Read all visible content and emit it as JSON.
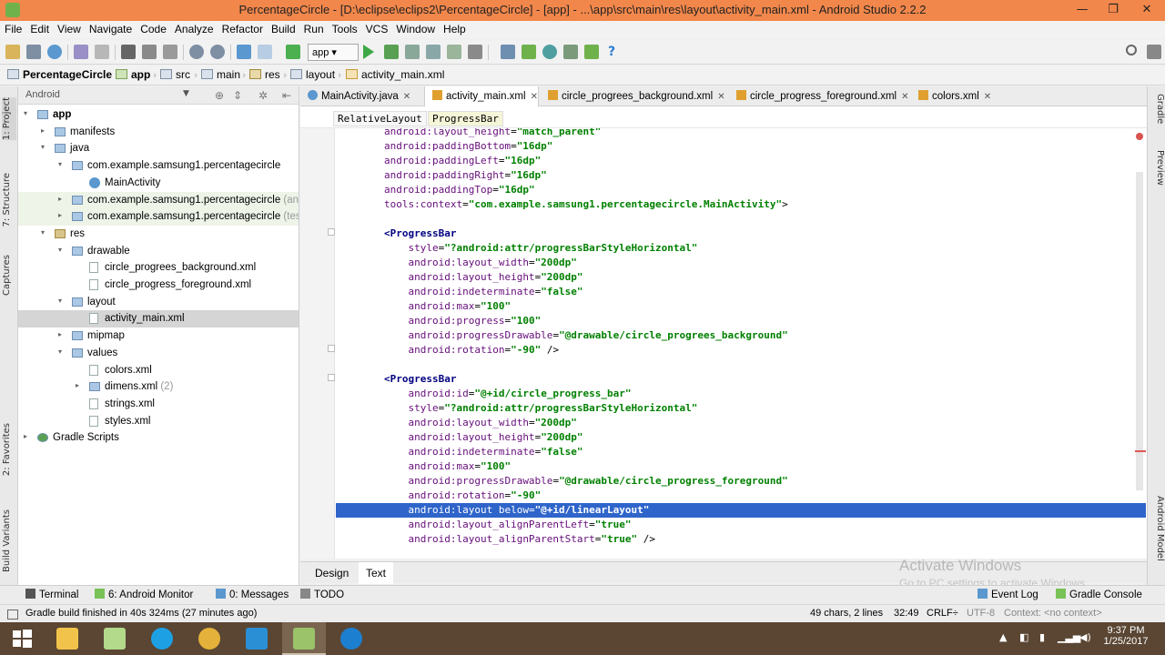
{
  "window": {
    "title": "PercentageCircle - [D:\\eclipse\\eclips2\\PercentageCircle] - [app] - ...\\app\\src\\main\\res\\layout\\activity_main.xml - Android Studio 2.2.2",
    "minimize": "—",
    "maximize": "❐",
    "close": "✕"
  },
  "menu": [
    "File",
    "Edit",
    "View",
    "Navigate",
    "Code",
    "Analyze",
    "Refactor",
    "Build",
    "Run",
    "Tools",
    "VCS",
    "Window",
    "Help"
  ],
  "toolbar": {
    "run_config": "app ▾",
    "icons": [
      "open-icon",
      "save-icon",
      "sync-icon",
      "undo-icon",
      "redo-icon",
      "cut-icon",
      "copy-icon",
      "paste-icon",
      "find-icon",
      "replace-icon",
      "back-icon",
      "forward-icon",
      "build-icon",
      "run-icon",
      "debug-icon",
      "profile-icon",
      "attach-icon",
      "stop-icon",
      "avd-manager-icon",
      "sdk-manager-icon",
      "gradle-sync-icon",
      "device-monitor-icon",
      "help-icon",
      "search-icon"
    ]
  },
  "breadcrumb": [
    "PercentageCircle",
    "app",
    "src",
    "main",
    "res",
    "layout",
    "activity_main.xml"
  ],
  "left_strip": [
    "1: Project",
    "7: Structure",
    "Captures",
    "2: Favorites",
    "Build Variants"
  ],
  "project_panel": {
    "view_selector": "Android",
    "tree": [
      {
        "label": "app",
        "depth": 0,
        "arrow": "▾",
        "icon": "folder",
        "bold": true
      },
      {
        "label": "manifests",
        "depth": 1,
        "arrow": "▸",
        "icon": "folder"
      },
      {
        "label": "java",
        "depth": 1,
        "arrow": "▾",
        "icon": "folder"
      },
      {
        "label": "com.example.samsung1.percentagecircle",
        "depth": 2,
        "arrow": "▾",
        "icon": "folder"
      },
      {
        "label": "MainActivity",
        "depth": 3,
        "arrow": "",
        "icon": "class"
      },
      {
        "label": "com.example.samsung1.percentagecircle",
        "suffix": " (andr",
        "depth": 2,
        "arrow": "▸",
        "icon": "folder",
        "tinted": true
      },
      {
        "label": "com.example.samsung1.percentagecircle",
        "suffix": " (test)",
        "depth": 2,
        "arrow": "▸",
        "icon": "folder",
        "tinted": true
      },
      {
        "label": "res",
        "depth": 1,
        "arrow": "▾",
        "icon": "res"
      },
      {
        "label": "drawable",
        "depth": 2,
        "arrow": "▾",
        "icon": "folder"
      },
      {
        "label": "circle_progrees_background.xml",
        "depth": 3,
        "arrow": "",
        "icon": "xml"
      },
      {
        "label": "circle_progress_foreground.xml",
        "depth": 3,
        "arrow": "",
        "icon": "xml"
      },
      {
        "label": "layout",
        "depth": 2,
        "arrow": "▾",
        "icon": "folder"
      },
      {
        "label": "activity_main.xml",
        "depth": 3,
        "arrow": "",
        "icon": "xml",
        "selected": true
      },
      {
        "label": "mipmap",
        "depth": 2,
        "arrow": "▸",
        "icon": "folder"
      },
      {
        "label": "values",
        "depth": 2,
        "arrow": "▾",
        "icon": "folder"
      },
      {
        "label": "colors.xml",
        "depth": 3,
        "arrow": "",
        "icon": "xml"
      },
      {
        "label": "dimens.xml",
        "suffix": " (2)",
        "depth": 3,
        "arrow": "▸",
        "icon": "folder"
      },
      {
        "label": "strings.xml",
        "depth": 3,
        "arrow": "",
        "icon": "xml"
      },
      {
        "label": "styles.xml",
        "depth": 3,
        "arrow": "",
        "icon": "xml"
      },
      {
        "label": "Gradle Scripts",
        "depth": 0,
        "arrow": "▸",
        "icon": "gradle"
      }
    ]
  },
  "editor_tabs": [
    {
      "label": "MainActivity.java",
      "active": false,
      "color": "#5a98cf"
    },
    {
      "label": "activity_main.xml",
      "active": true,
      "color": "#e0a030"
    },
    {
      "label": "circle_progrees_background.xml",
      "active": false,
      "color": "#e0a030"
    },
    {
      "label": "circle_progress_foreground.xml",
      "active": false,
      "color": "#e0a030"
    },
    {
      "label": "colors.xml",
      "active": false,
      "color": "#e0a030"
    }
  ],
  "xml_crumbs": [
    "RelativeLayout",
    "ProgressBar"
  ],
  "code_lines": [
    {
      "indent": "    ",
      "ns": "android:",
      "attr": "layout_height",
      "val": "\"match_parent\""
    },
    {
      "indent": "    ",
      "ns": "android:",
      "attr": "paddingBottom",
      "val": "\"16dp\""
    },
    {
      "indent": "    ",
      "ns": "android:",
      "attr": "paddingLeft",
      "val": "\"16dp\""
    },
    {
      "indent": "    ",
      "ns": "android:",
      "attr": "paddingRight",
      "val": "\"16dp\""
    },
    {
      "indent": "    ",
      "ns": "android:",
      "attr": "paddingTop",
      "val": "\"16dp\""
    },
    {
      "indent": "    ",
      "ns": "tools:",
      "attr": "context",
      "val": "\"com.example.samsung1.percentagecircle.MainActivity\"",
      "tail": ">"
    },
    {
      "indent": "",
      "raw": ""
    },
    {
      "indent": "    ",
      "tag": "<ProgressBar"
    },
    {
      "indent": "        ",
      "ns": "",
      "attr": "style",
      "val": "\"?android:attr/progressBarStyleHorizontal\""
    },
    {
      "indent": "        ",
      "ns": "android:",
      "attr": "layout_width",
      "val": "\"200dp\""
    },
    {
      "indent": "        ",
      "ns": "android:",
      "attr": "layout_height",
      "val": "\"200dp\""
    },
    {
      "indent": "        ",
      "ns": "android:",
      "attr": "indeterminate",
      "val": "\"false\""
    },
    {
      "indent": "        ",
      "ns": "android:",
      "attr": "max",
      "val": "\"100\""
    },
    {
      "indent": "        ",
      "ns": "android:",
      "attr": "progress",
      "val": "\"100\""
    },
    {
      "indent": "        ",
      "ns": "android:",
      "attr": "progressDrawable",
      "val": "\"@drawable/circle_progrees_background\""
    },
    {
      "indent": "        ",
      "ns": "android:",
      "attr": "rotation",
      "val": "\"-90\"",
      "tail": " />"
    },
    {
      "indent": "",
      "raw": ""
    },
    {
      "indent": "    ",
      "tag": "<ProgressBar"
    },
    {
      "indent": "        ",
      "ns": "android:",
      "attr": "id",
      "val": "\"@+id/circle_progress_bar\""
    },
    {
      "indent": "        ",
      "ns": "",
      "attr": "style",
      "val": "\"?android:attr/progressBarStyleHorizontal\""
    },
    {
      "indent": "        ",
      "ns": "android:",
      "attr": "layout_width",
      "val": "\"200dp\""
    },
    {
      "indent": "        ",
      "ns": "android:",
      "attr": "layout_height",
      "val": "\"200dp\""
    },
    {
      "indent": "        ",
      "ns": "android:",
      "attr": "indeterminate",
      "val": "\"false\""
    },
    {
      "indent": "        ",
      "ns": "android:",
      "attr": "max",
      "val": "\"100\""
    },
    {
      "indent": "        ",
      "ns": "android:",
      "attr": "progressDrawable",
      "val": "\"@drawable/circle_progress_foreground\""
    },
    {
      "indent": "        ",
      "ns": "android:",
      "attr": "rotation",
      "val": "\"-90\""
    },
    {
      "indent": "        ",
      "ns": "android:",
      "attr": "layout below",
      "val": "\"@+id/linearLayout\"",
      "highlight": true
    },
    {
      "indent": "        ",
      "ns": "android:",
      "attr": "layout_alignParentLeft",
      "val": "\"true\""
    },
    {
      "indent": "        ",
      "ns": "android:",
      "attr": "layout_alignParentStart",
      "val": "\"true\"",
      "tail": " />"
    }
  ],
  "design_tabs": [
    {
      "label": "Design",
      "active": false
    },
    {
      "label": "Text",
      "active": true
    }
  ],
  "watermark": {
    "line1": "Activate Windows",
    "line2": "Go to PC settings to activate Windows."
  },
  "right_strip": [
    "Gradle",
    "Preview",
    "Android Model"
  ],
  "bottom_tools": [
    {
      "label": "Terminal",
      "color": "#555"
    },
    {
      "label": "6: Android Monitor",
      "color": "#78c257"
    },
    {
      "label": "0: Messages",
      "color": "#5a98cf"
    },
    {
      "label": "TODO",
      "color": "#888"
    },
    {
      "label": "Event Log",
      "color": "#5a98cf"
    },
    {
      "label": "Gradle Console",
      "color": "#78c257"
    }
  ],
  "status": {
    "message": "Gradle build finished in 40s 324ms (27 minutes ago)",
    "selection": "49 chars, 2 lines",
    "position": "32:49",
    "line_sep": "CRLF÷",
    "encoding": "UTF-8",
    "context": "Context: <no context>"
  },
  "taskbar": {
    "apps": [
      {
        "name": "file-explorer",
        "color": "#f1c34b"
      },
      {
        "name": "notepad",
        "color": "#b3d98a"
      },
      {
        "name": "skype",
        "color": "#1ea0e4"
      },
      {
        "name": "chrome",
        "color": "#e4b23a"
      },
      {
        "name": "screen-capture",
        "color": "#2b8fd6"
      },
      {
        "name": "android-studio",
        "color": "#9ac36a",
        "active": true
      },
      {
        "name": "vlink",
        "color": "#1d7fd0"
      }
    ],
    "time": "9:37 PM",
    "date": "1/25/2017"
  }
}
